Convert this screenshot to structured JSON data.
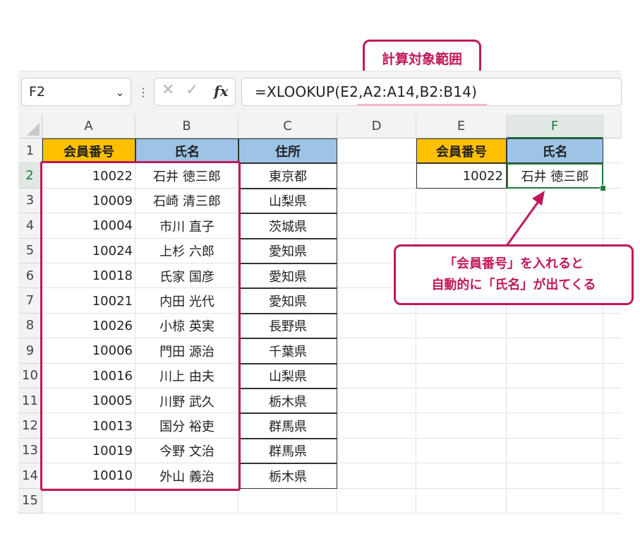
{
  "formula_bar": {
    "name_box": "F2",
    "formula": "=XLOOKUP(E2,A2:A14,B2:B14)",
    "cancel_glyph": "✕",
    "enter_glyph": "✓",
    "fx_label": "fx"
  },
  "annotations": {
    "range_callout": "計算対象範囲",
    "info_line1": "「会員番号」を入れると",
    "info_line2": "自動的に「氏名」が出てくる",
    "accent_color": "#c0185c"
  },
  "sheet": {
    "columns": [
      "A",
      "B",
      "C",
      "D",
      "E",
      "F"
    ],
    "selected_column": "F",
    "rows": [
      "1",
      "2",
      "3",
      "4",
      "5",
      "6",
      "7",
      "8",
      "9",
      "10",
      "11",
      "12",
      "13",
      "14",
      "15"
    ],
    "selected_row": "2",
    "table_headers": {
      "id": "会員番号",
      "name": "氏名",
      "address": "住所"
    },
    "table_rows": [
      {
        "id": "10022",
        "name": "石井 徳三郎",
        "address": "東京都"
      },
      {
        "id": "10009",
        "name": "石崎 清三郎",
        "address": "山梨県"
      },
      {
        "id": "10004",
        "name": "市川 直子",
        "address": "茨城県"
      },
      {
        "id": "10024",
        "name": "上杉 六郎",
        "address": "愛知県"
      },
      {
        "id": "10018",
        "name": "氏家 国彦",
        "address": "愛知県"
      },
      {
        "id": "10021",
        "name": "内田 光代",
        "address": "愛知県"
      },
      {
        "id": "10026",
        "name": "小椋 英実",
        "address": "長野県"
      },
      {
        "id": "10006",
        "name": "門田 源治",
        "address": "千葉県"
      },
      {
        "id": "10016",
        "name": "川上 由夫",
        "address": "山梨県"
      },
      {
        "id": "10005",
        "name": "川野 武久",
        "address": "栃木県"
      },
      {
        "id": "10013",
        "name": "国分 裕吏",
        "address": "群馬県"
      },
      {
        "id": "10019",
        "name": "今野 文治",
        "address": "群馬県"
      },
      {
        "id": "10010",
        "name": "外山 義治",
        "address": "栃木県"
      }
    ],
    "lookup": {
      "header_id": "会員番号",
      "header_name": "氏名",
      "input_id": "10022",
      "result_name": "石井 徳三郎"
    },
    "colors": {
      "header_gold": "#ffc000",
      "header_blue": "#9dc3e6",
      "selection_green": "#1f7a3c"
    }
  }
}
